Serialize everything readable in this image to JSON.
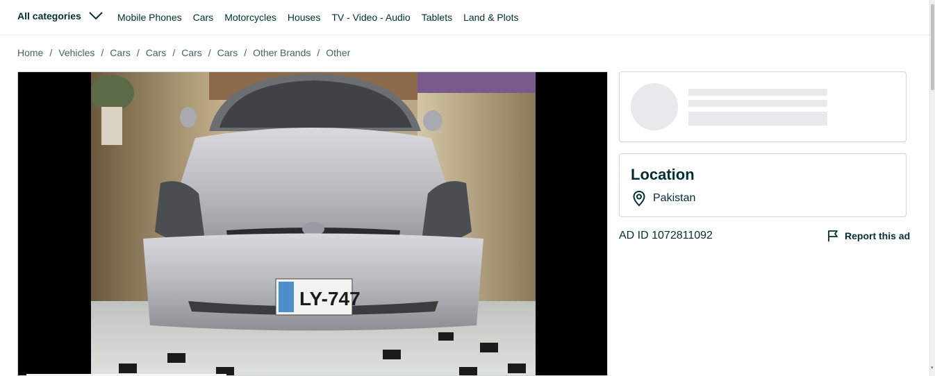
{
  "category_bar": {
    "all_categories_label": "All categories",
    "links": [
      "Mobile Phones",
      "Cars",
      "Motorcycles",
      "Houses",
      "TV - Video - Audio",
      "Tablets",
      "Land & Plots"
    ]
  },
  "breadcrumb": [
    "Home",
    "Vehicles",
    "Cars",
    "Cars",
    "Cars",
    "Cars",
    "Other Brands",
    "Other"
  ],
  "breadcrumb_separator": "/",
  "gallery": {
    "photo_subject": "silver hatchback car front view",
    "plate_text": "LY-747"
  },
  "location": {
    "title": "Location",
    "place": "Pakistan"
  },
  "ad": {
    "id_text": "AD ID 1072811092",
    "report_label": "Report this ad"
  },
  "colors": {
    "text_primary": "#002f34",
    "text_secondary": "#406367",
    "border": "#cfd6d7",
    "skeleton": "#e6eaea"
  }
}
